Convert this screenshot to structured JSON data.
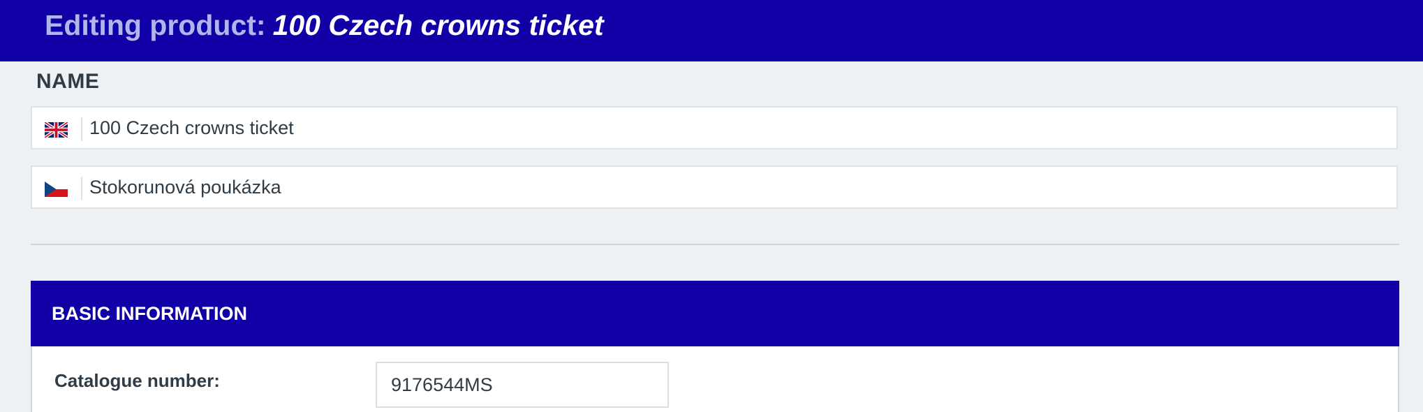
{
  "header": {
    "prefix": "Editing product:",
    "product_name": "100 Czech crowns ticket",
    "background_color": "#1100a6"
  },
  "name_section": {
    "label": "NAME",
    "translations": [
      {
        "language_icon": "uk-flag-icon",
        "value": "100 Czech crowns ticket"
      },
      {
        "language_icon": "cz-flag-icon",
        "value": "Stokorunová poukázka"
      }
    ]
  },
  "basic_information": {
    "title": "BASIC INFORMATION",
    "catalogue_number_label": "Catalogue number:",
    "catalogue_number_value": "9176544MS"
  }
}
